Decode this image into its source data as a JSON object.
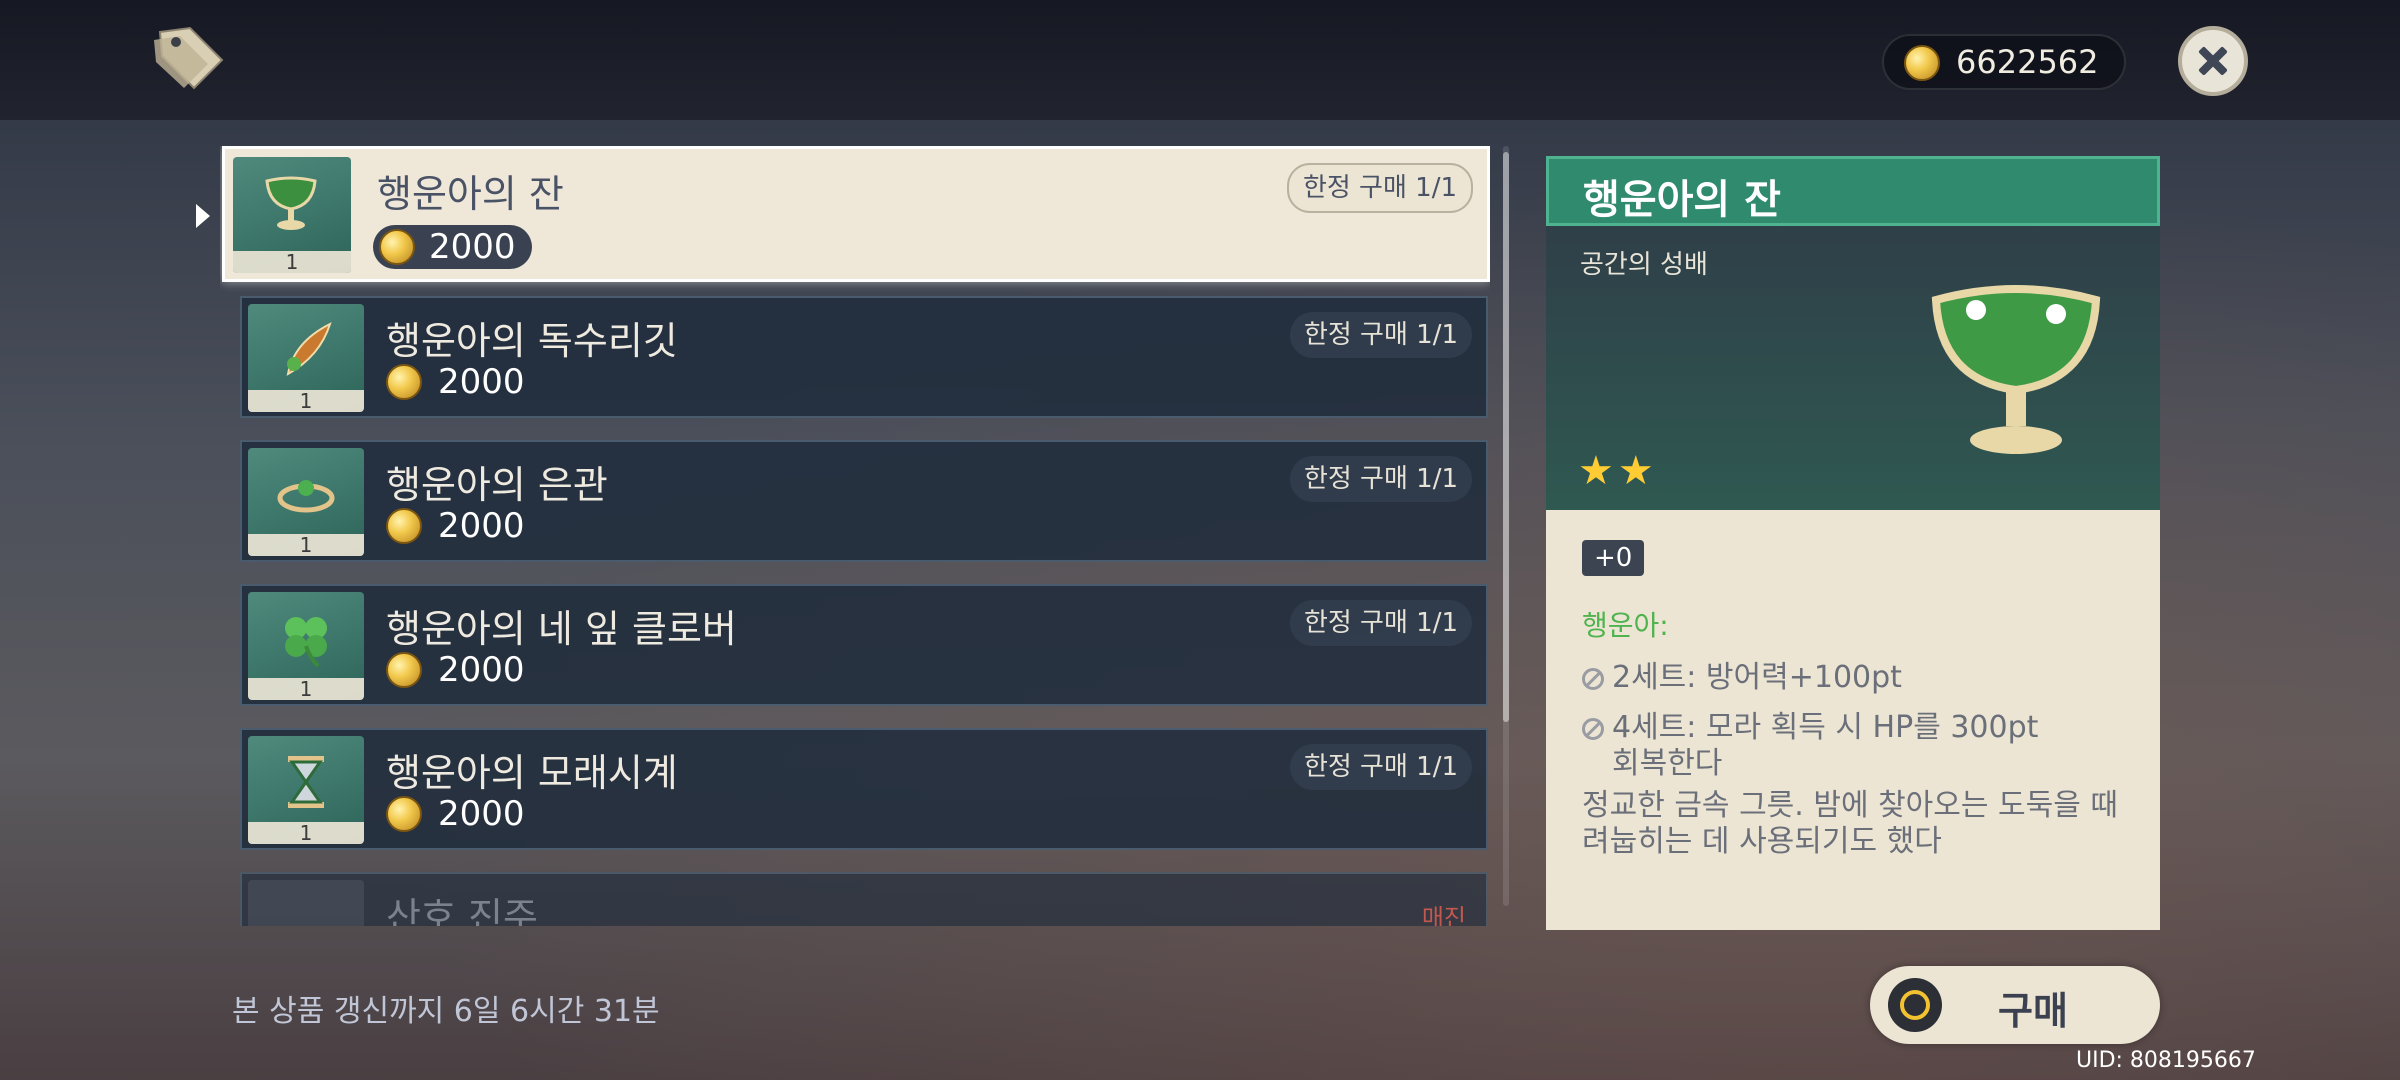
{
  "header": {
    "currency_value": "6622562"
  },
  "list": {
    "items": [
      {
        "name": "행운아의 잔",
        "price": "2000",
        "limit": "한정 구매 1/1",
        "qty": "1"
      },
      {
        "name": "행운아의 독수리깃",
        "price": "2000",
        "limit": "한정 구매 1/1",
        "qty": "1"
      },
      {
        "name": "행운아의 은관",
        "price": "2000",
        "limit": "한정 구매 1/1",
        "qty": "1"
      },
      {
        "name": "행운아의 네 잎 클로버",
        "price": "2000",
        "limit": "한정 구매 1/1",
        "qty": "1"
      },
      {
        "name": "행운아의 모래시계",
        "price": "2000",
        "limit": "한정 구매 1/1",
        "qty": "1"
      },
      {
        "name": "산호 진주",
        "soldout": "매진"
      }
    ]
  },
  "detail": {
    "title": "행운아의 잔",
    "type": "공간의 성배",
    "stars": "★★",
    "level": "+0",
    "set_name": "행운아:",
    "set2": "2세트: 방어력+100pt",
    "set4_line1": "4세트: 모라 획득 시 HP를 300pt",
    "set4_line2": "회복한다",
    "description": "정교한 금속 그릇. 밤에 찾아오는 도둑을 때려눕히는 데 사용되기도 했다"
  },
  "footer": {
    "refresh_text": "본 상품 갱신까지 6일 6시간 31분",
    "buy_label": "구매",
    "uid": "UID: 808195667"
  },
  "colors": {
    "accent_green": "#2f8a6e",
    "set_green": "#4fb34f",
    "soldout_red": "#e35a4d",
    "coin_gold": "#f2c94c"
  },
  "icons": [
    "shop-tag-icon",
    "mora-coin-icon",
    "close-icon",
    "artifact-goblet-icon",
    "artifact-feather-icon",
    "artifact-circlet-icon",
    "artifact-clover-icon",
    "artifact-hourglass-icon",
    "disabled-icon",
    "confirm-button-icon"
  ]
}
